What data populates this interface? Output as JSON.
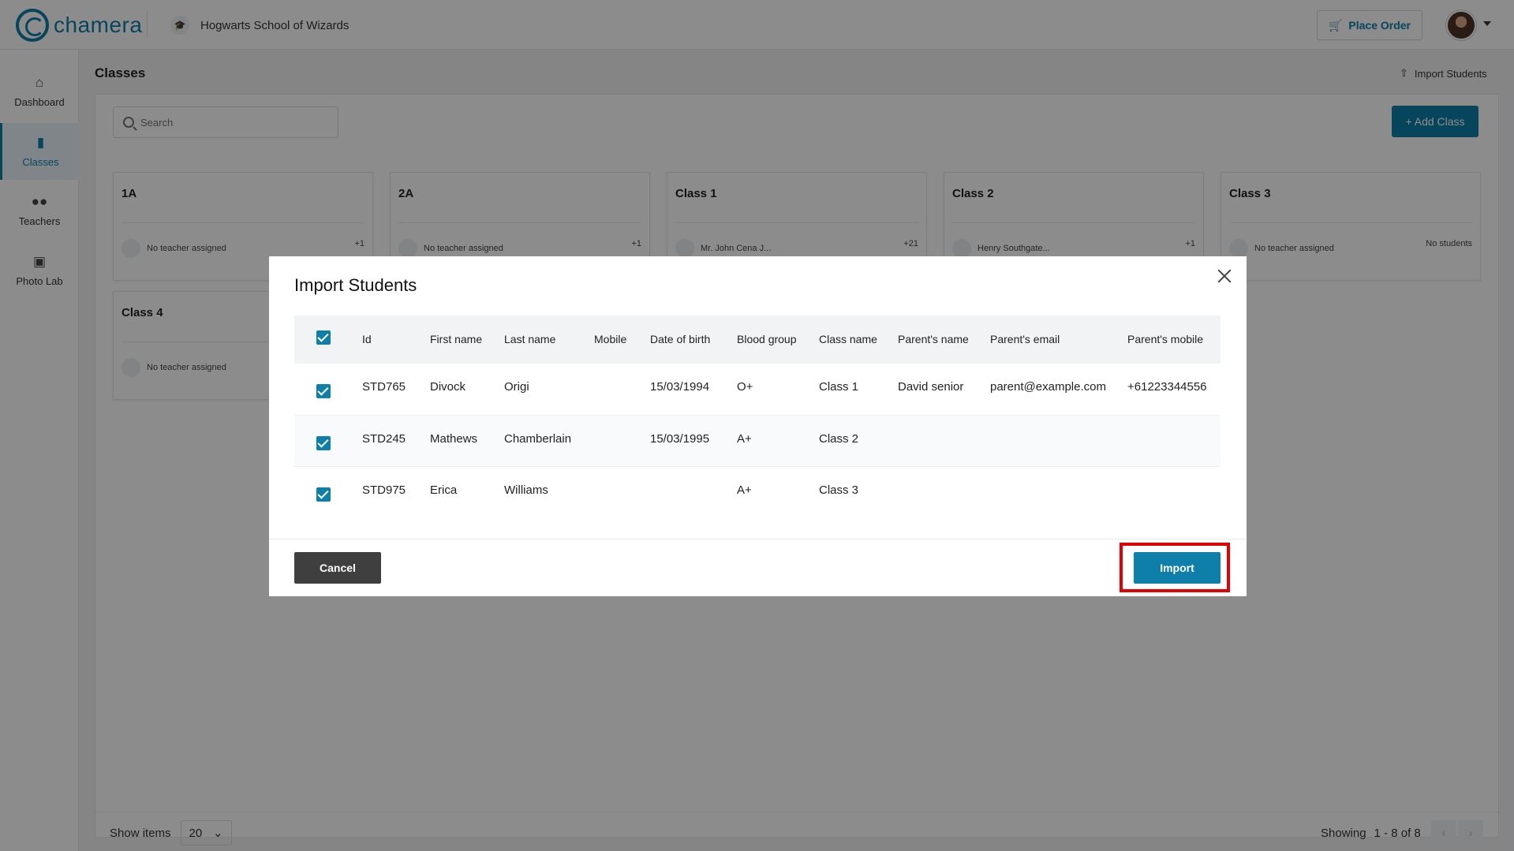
{
  "app": {
    "logo_text": "chamera",
    "school_name": "Hogwarts School of Wizards",
    "place_order_label": "Place Order"
  },
  "sidebar": {
    "items": [
      {
        "label": "Dashboard",
        "icon": "home-icon",
        "active": false
      },
      {
        "label": "Classes",
        "icon": "book-icon",
        "active": true
      },
      {
        "label": "Teachers",
        "icon": "people-icon",
        "active": false
      },
      {
        "label": "Photo Lab",
        "icon": "camera-icon",
        "active": false
      }
    ]
  },
  "main": {
    "title": "Classes",
    "import_link": "Import Students",
    "search_placeholder": "Search",
    "add_class_label": "+ Add Class",
    "classes": [
      {
        "name": "1A",
        "teacher": "No teacher assigned",
        "students": "+1"
      },
      {
        "name": "2A",
        "teacher": "No teacher assigned",
        "students": "+1"
      },
      {
        "name": "Class 1",
        "teacher": "Mr. John Cena J...",
        "students": "+21"
      },
      {
        "name": "Class 2",
        "teacher": "Henry Southgate...",
        "students": "+1"
      },
      {
        "name": "Class 3",
        "teacher": "No teacher assigned",
        "students": "No students"
      },
      {
        "name": "Class 4",
        "teacher": "No teacher assigned",
        "students": ""
      }
    ],
    "show_items_label": "Show items",
    "page_size": "20",
    "showing_label": "Showing",
    "showing_range": "1 - 8 of 8"
  },
  "modal": {
    "title": "Import Students",
    "columns": [
      "Id",
      "First name",
      "Last name",
      "Mobile",
      "Date of birth",
      "Blood group",
      "Class name",
      "Parent's name",
      "Parent's email",
      "Parent's mobile"
    ],
    "rows": [
      {
        "id": "STD765",
        "first_name": "Divock",
        "last_name": "Origi",
        "mobile": "",
        "dob": "15/03/1994",
        "blood": "O+",
        "class_name": "Class 1",
        "parent_name": "David senior",
        "parent_email": "parent@example.com",
        "parent_mobile": "+61223344556"
      },
      {
        "id": "STD245",
        "first_name": "Mathews",
        "last_name": "Chamberlain",
        "mobile": "",
        "dob": "15/03/1995",
        "blood": "A+",
        "class_name": "Class 2",
        "parent_name": "",
        "parent_email": "",
        "parent_mobile": ""
      },
      {
        "id": "STD975",
        "first_name": "Erica",
        "last_name": "Williams",
        "mobile": "",
        "dob": "",
        "blood": "A+",
        "class_name": "Class 3",
        "parent_name": "",
        "parent_email": "",
        "parent_mobile": ""
      }
    ],
    "cancel_label": "Cancel",
    "import_label": "Import"
  },
  "colors": {
    "accent": "#0e7fa8",
    "highlight": "#e40000",
    "cancel": "#3f3f3f"
  }
}
